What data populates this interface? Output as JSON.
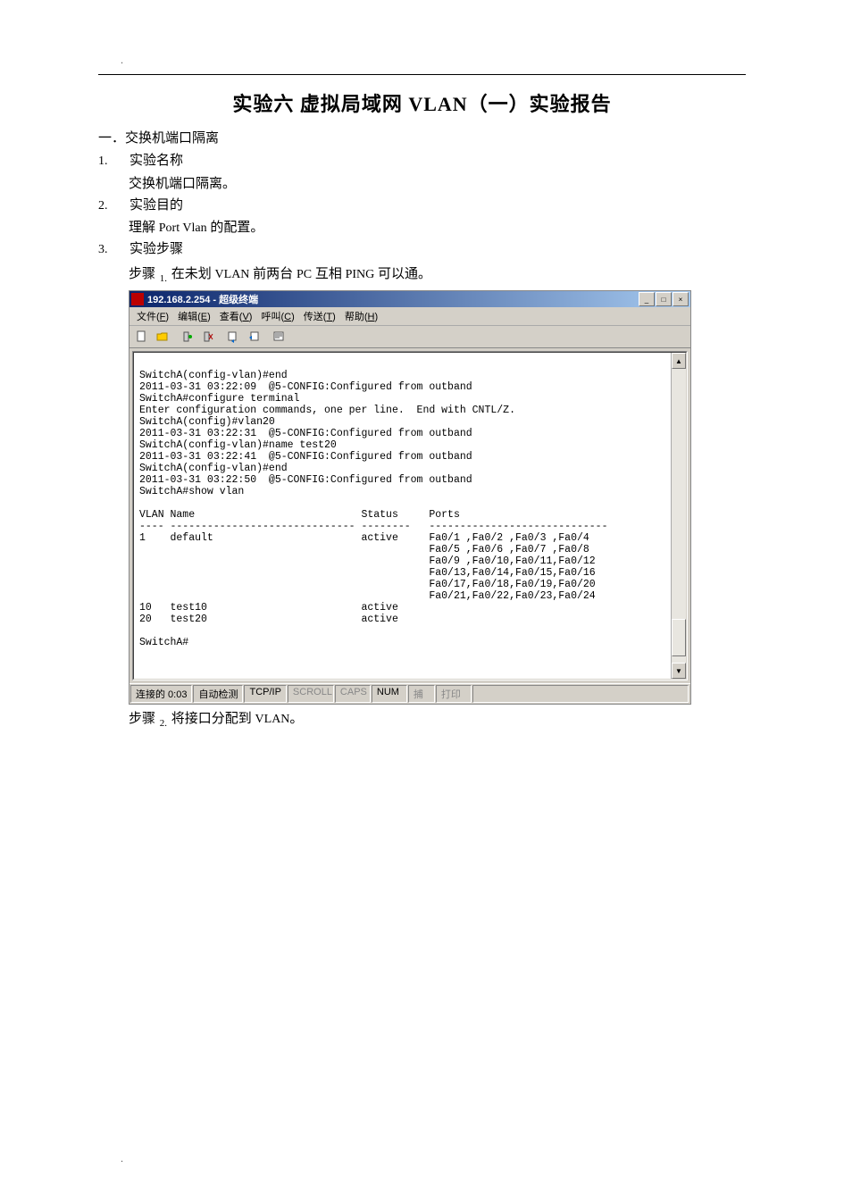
{
  "page_dot": ".",
  "doc": {
    "title": "实验六 虚拟局域网 VLAN（一）实验报告",
    "section1": "一．交换机端口隔离",
    "item1_no": "1.",
    "item1_label": "实验名称",
    "item1_body": "交换机端口隔离。",
    "item2_no": "2.",
    "item2_label": "实验目的",
    "item2_body_pre": "理解 ",
    "item2_body_roman": "Port  Vlan",
    "item2_body_post": " 的配置。",
    "item3_no": "3.",
    "item3_label": "实验步骤",
    "step1_pre": "步骤 ",
    "step1_sub": "1.",
    "step1_mid": " 在未划 ",
    "step1_r1": "VLAN",
    "step1_mid2": " 前两台 ",
    "step1_r2": "PC",
    "step1_mid3": " 互相 ",
    "step1_r3": "PING",
    "step1_post": " 可以通。",
    "step2_pre": "步骤 ",
    "step2_sub": "2.",
    "step2_mid": " 将接口分配到 ",
    "step2_r1": "VLAN",
    "step2_post": "。"
  },
  "ht": {
    "title": "192.168.2.254 - 超级终端",
    "menu": {
      "file": "文件(F)",
      "edit": "编辑(E)",
      "view": "查看(V)",
      "call": "呼叫(C)",
      "transfer": "传送(T)",
      "help": "帮助(H)"
    },
    "win_btns": {
      "min": "_",
      "max": "□",
      "close": "×"
    },
    "terminal_lines": [
      "",
      "SwitchA(config-vlan)#end",
      "2011-03-31 03:22:09  @5-CONFIG:Configured from outband",
      "SwitchA#configure terminal",
      "Enter configuration commands, one per line.  End with CNTL/Z.",
      "SwitchA(config)#vlan20",
      "2011-03-31 03:22:31  @5-CONFIG:Configured from outband",
      "SwitchA(config-vlan)#name test20",
      "2011-03-31 03:22:41  @5-CONFIG:Configured from outband",
      "SwitchA(config-vlan)#end",
      "2011-03-31 03:22:50  @5-CONFIG:Configured from outband",
      "SwitchA#show vlan",
      "",
      "VLAN Name                           Status     Ports",
      "---- ------------------------------ --------   -----------------------------",
      "1    default                        active     Fa0/1 ,Fa0/2 ,Fa0/3 ,Fa0/4",
      "                                               Fa0/5 ,Fa0/6 ,Fa0/7 ,Fa0/8",
      "                                               Fa0/9 ,Fa0/10,Fa0/11,Fa0/12",
      "                                               Fa0/13,Fa0/14,Fa0/15,Fa0/16",
      "                                               Fa0/17,Fa0/18,Fa0/19,Fa0/20",
      "                                               Fa0/21,Fa0/22,Fa0/23,Fa0/24",
      "10   test10                         active",
      "20   test20                         active",
      "",
      "SwitchA#"
    ],
    "status": {
      "conn": "连接的 0:03",
      "detect": "自动检测",
      "proto": "TCP/IP",
      "scroll": "SCROLL",
      "caps": "CAPS",
      "num": "NUM",
      "catch": "捕",
      "print": "打印"
    }
  }
}
